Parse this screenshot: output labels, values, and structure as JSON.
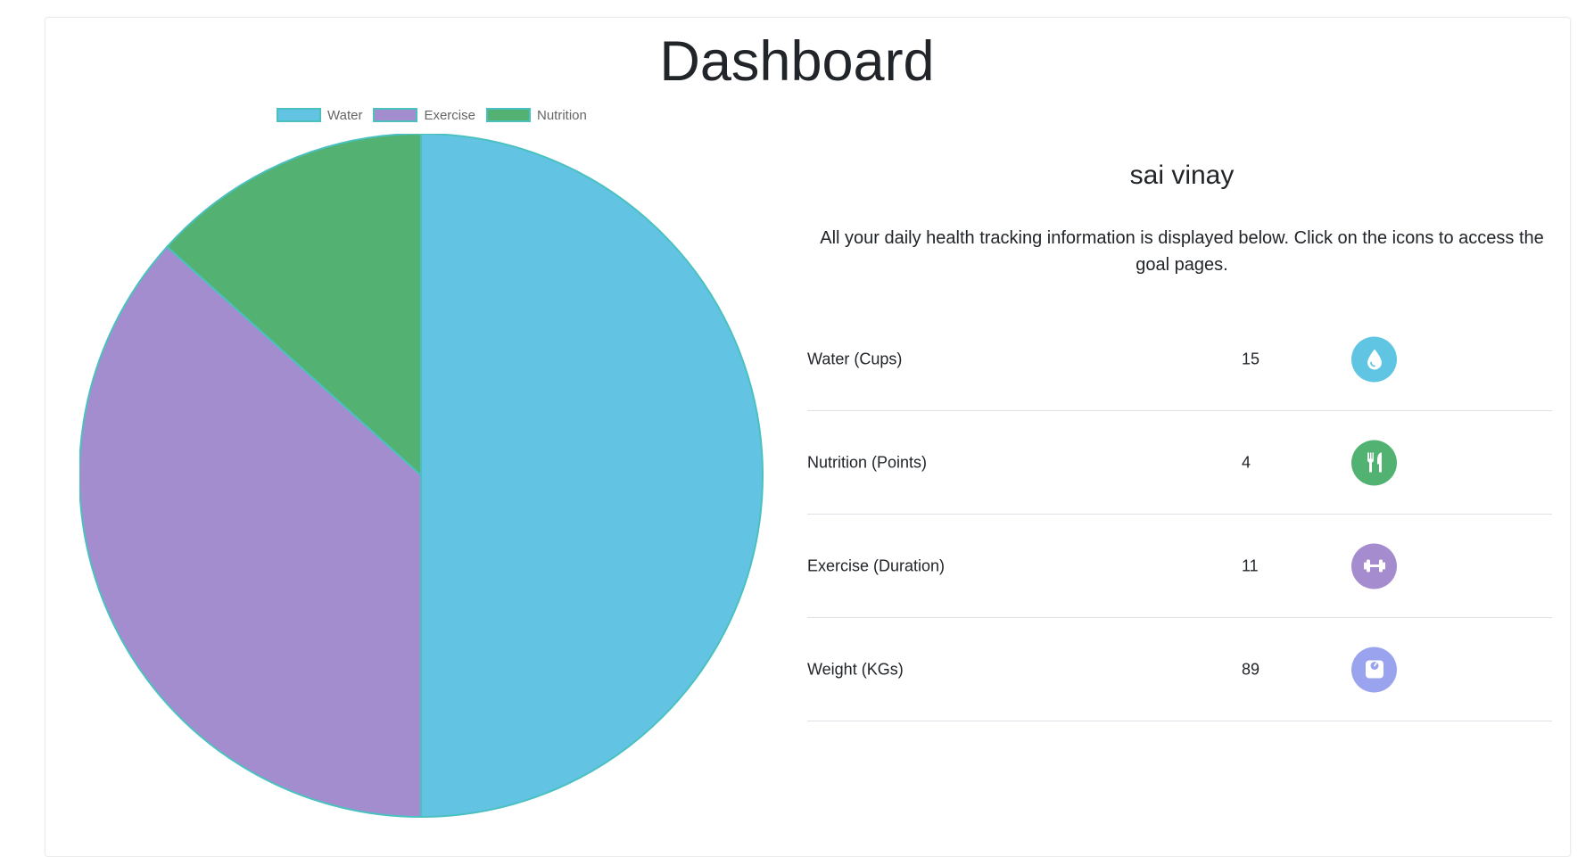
{
  "page": {
    "title": "Dashboard"
  },
  "profile": {
    "name": "sai vinay",
    "intro": "All your daily health tracking information is displayed below. Click on the icons to access the goal pages."
  },
  "stats": [
    {
      "label": "Water (Cups)",
      "value": "15",
      "icon": "water-drop-icon",
      "color": "#5fc5e2"
    },
    {
      "label": "Nutrition (Points)",
      "value": "4",
      "icon": "utensils-icon",
      "color": "#52b272"
    },
    {
      "label": "Exercise (Duration)",
      "value": "11",
      "icon": "dumbbell-icon",
      "color": "#a58ccf"
    },
    {
      "label": "Weight (KGs)",
      "value": "89",
      "icon": "scale-icon",
      "color": "#9aa3ee"
    }
  ],
  "chart_data": {
    "type": "pie",
    "title": "",
    "legend_position": "top",
    "categories": [
      "Water",
      "Exercise",
      "Nutrition"
    ],
    "values": [
      15,
      11,
      4
    ],
    "colors": [
      "#62c4e2",
      "#a48dcf",
      "#53b272"
    ],
    "border_color": "#4bc0c0"
  }
}
